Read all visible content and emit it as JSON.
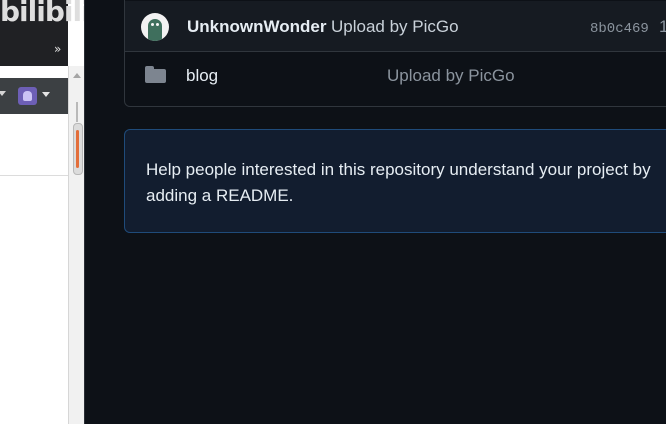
{
  "left_window": {
    "logo_text": "bilibili",
    "overflow_chevrons": "»"
  },
  "repo": {
    "latest_commit": {
      "author": "UnknownWonder",
      "message": "Upload by PicGo",
      "hash": "8b0c469",
      "extra": "1"
    },
    "files": [
      {
        "type": "folder",
        "name": "blog",
        "message": "Upload by PicGo"
      }
    ],
    "readme_prompt": "Help people interested in this repository understand your project by adding a README."
  },
  "colors": {
    "page_bg": "#0d1117",
    "readme_bg": "#121d2f",
    "readme_border": "#1f4b7a",
    "scroll_accent": "#e36e3a"
  }
}
